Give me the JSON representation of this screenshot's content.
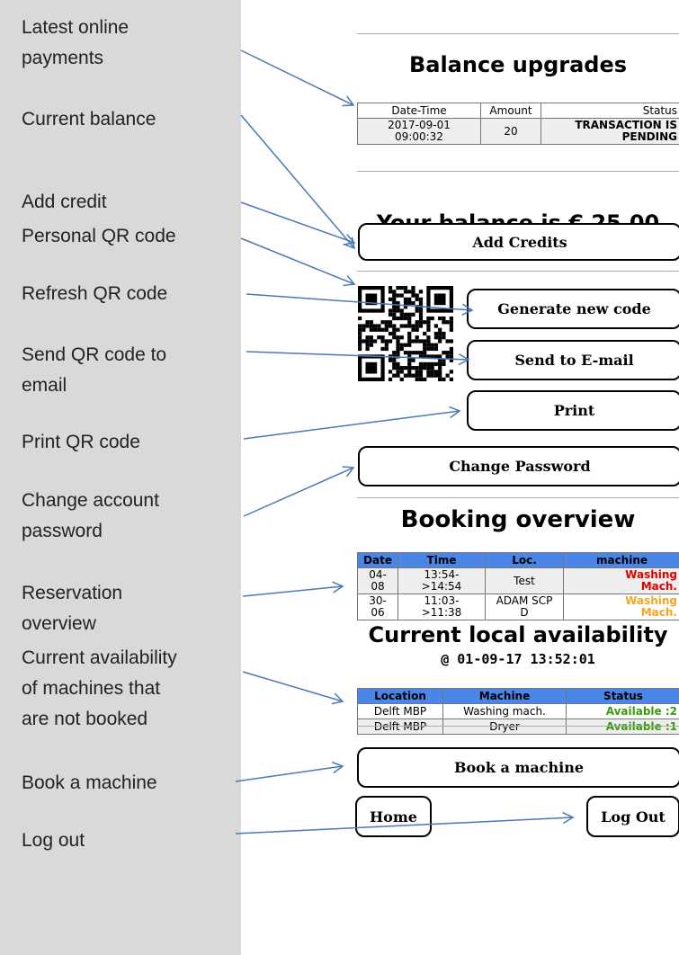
{
  "sidebar": {
    "labels": [
      "Latest online\npayments",
      "Current balance",
      "Add credit",
      "Personal QR code",
      "Refresh QR code",
      "Send QR code to\nemail",
      "Print QR code",
      "Change account\npassword",
      "Reservation\noverview",
      "Current availability\nof machines that\nare not booked",
      "Book a machine",
      "Log out"
    ]
  },
  "balance_upgrades": {
    "title": "Balance upgrades",
    "headers": [
      "Date-Time",
      "Amount",
      "Status"
    ],
    "rows": [
      {
        "datetime": "2017-09-01\n09:00:32",
        "amount": "20",
        "status": "TRANSACTION IS\nPENDING",
        "status_color": "#f5a623"
      }
    ]
  },
  "balance": {
    "text": "Your balance is € 25,00"
  },
  "buttons": {
    "add_credits": "Add Credits",
    "generate_code": "Generate new code",
    "send_email": "Send to E-mail",
    "print": "Print",
    "change_password": "Change Password",
    "book_machine": "Book a machine",
    "home": "Home",
    "logout": "Log Out"
  },
  "booking": {
    "title": "Booking overview",
    "header_color": "#4a86e8",
    "headers": [
      "Date",
      "Time",
      "Loc.",
      "machine"
    ],
    "rows": [
      {
        "date": "04-\n08",
        "time": "13:54-\n>14:54",
        "loc": "Test",
        "machine": "Washing\nMach.",
        "machine_color": "#e00000"
      },
      {
        "date": "30-\n06",
        "time": "11:03-\n>11:38",
        "loc": "ADAM SCP\nD",
        "machine": "Washing\nMach.",
        "machine_color": "#f5a623"
      }
    ]
  },
  "availability": {
    "title": "Current local availability",
    "timestamp": "@ 01-09-17 13:52:01",
    "headers": [
      "Location",
      "Machine",
      "Status"
    ],
    "rows": [
      {
        "location": "Delft MBP",
        "machine": "Washing mach.",
        "status": "Available :2",
        "status_color": "#3c9a0f"
      },
      {
        "location": "Delft MBP",
        "machine": "Dryer",
        "status": "Available :1",
        "status_color": "#3c9a0f"
      }
    ]
  },
  "colors": {
    "sidebar_bg": "#d9d9d9",
    "arrow": "#4a7ab5",
    "table_header": "#4a86e8"
  }
}
